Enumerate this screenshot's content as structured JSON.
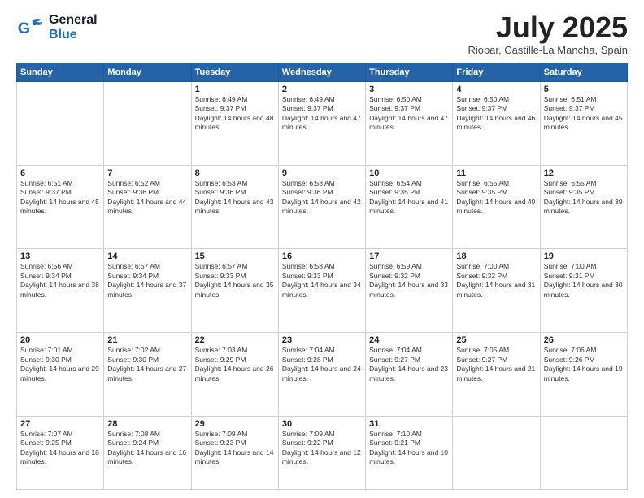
{
  "header": {
    "logo_general": "General",
    "logo_blue": "Blue",
    "month": "July 2025",
    "location": "Riopar, Castille-La Mancha, Spain"
  },
  "weekdays": [
    "Sunday",
    "Monday",
    "Tuesday",
    "Wednesday",
    "Thursday",
    "Friday",
    "Saturday"
  ],
  "weeks": [
    [
      {
        "day": "",
        "sunrise": "",
        "sunset": "",
        "daylight": ""
      },
      {
        "day": "",
        "sunrise": "",
        "sunset": "",
        "daylight": ""
      },
      {
        "day": "1",
        "sunrise": "Sunrise: 6:49 AM",
        "sunset": "Sunset: 9:37 PM",
        "daylight": "Daylight: 14 hours and 48 minutes."
      },
      {
        "day": "2",
        "sunrise": "Sunrise: 6:49 AM",
        "sunset": "Sunset: 9:37 PM",
        "daylight": "Daylight: 14 hours and 47 minutes."
      },
      {
        "day": "3",
        "sunrise": "Sunrise: 6:50 AM",
        "sunset": "Sunset: 9:37 PM",
        "daylight": "Daylight: 14 hours and 47 minutes."
      },
      {
        "day": "4",
        "sunrise": "Sunrise: 6:50 AM",
        "sunset": "Sunset: 9:37 PM",
        "daylight": "Daylight: 14 hours and 46 minutes."
      },
      {
        "day": "5",
        "sunrise": "Sunrise: 6:51 AM",
        "sunset": "Sunset: 9:37 PM",
        "daylight": "Daylight: 14 hours and 45 minutes."
      }
    ],
    [
      {
        "day": "6",
        "sunrise": "Sunrise: 6:51 AM",
        "sunset": "Sunset: 9:37 PM",
        "daylight": "Daylight: 14 hours and 45 minutes."
      },
      {
        "day": "7",
        "sunrise": "Sunrise: 6:52 AM",
        "sunset": "Sunset: 9:36 PM",
        "daylight": "Daylight: 14 hours and 44 minutes."
      },
      {
        "day": "8",
        "sunrise": "Sunrise: 6:53 AM",
        "sunset": "Sunset: 9:36 PM",
        "daylight": "Daylight: 14 hours and 43 minutes."
      },
      {
        "day": "9",
        "sunrise": "Sunrise: 6:53 AM",
        "sunset": "Sunset: 9:36 PM",
        "daylight": "Daylight: 14 hours and 42 minutes."
      },
      {
        "day": "10",
        "sunrise": "Sunrise: 6:54 AM",
        "sunset": "Sunset: 9:35 PM",
        "daylight": "Daylight: 14 hours and 41 minutes."
      },
      {
        "day": "11",
        "sunrise": "Sunrise: 6:55 AM",
        "sunset": "Sunset: 9:35 PM",
        "daylight": "Daylight: 14 hours and 40 minutes."
      },
      {
        "day": "12",
        "sunrise": "Sunrise: 6:55 AM",
        "sunset": "Sunset: 9:35 PM",
        "daylight": "Daylight: 14 hours and 39 minutes."
      }
    ],
    [
      {
        "day": "13",
        "sunrise": "Sunrise: 6:56 AM",
        "sunset": "Sunset: 9:34 PM",
        "daylight": "Daylight: 14 hours and 38 minutes."
      },
      {
        "day": "14",
        "sunrise": "Sunrise: 6:57 AM",
        "sunset": "Sunset: 9:34 PM",
        "daylight": "Daylight: 14 hours and 37 minutes."
      },
      {
        "day": "15",
        "sunrise": "Sunrise: 6:57 AM",
        "sunset": "Sunset: 9:33 PM",
        "daylight": "Daylight: 14 hours and 35 minutes."
      },
      {
        "day": "16",
        "sunrise": "Sunrise: 6:58 AM",
        "sunset": "Sunset: 9:33 PM",
        "daylight": "Daylight: 14 hours and 34 minutes."
      },
      {
        "day": "17",
        "sunrise": "Sunrise: 6:59 AM",
        "sunset": "Sunset: 9:32 PM",
        "daylight": "Daylight: 14 hours and 33 minutes."
      },
      {
        "day": "18",
        "sunrise": "Sunrise: 7:00 AM",
        "sunset": "Sunset: 9:32 PM",
        "daylight": "Daylight: 14 hours and 31 minutes."
      },
      {
        "day": "19",
        "sunrise": "Sunrise: 7:00 AM",
        "sunset": "Sunset: 9:31 PM",
        "daylight": "Daylight: 14 hours and 30 minutes."
      }
    ],
    [
      {
        "day": "20",
        "sunrise": "Sunrise: 7:01 AM",
        "sunset": "Sunset: 9:30 PM",
        "daylight": "Daylight: 14 hours and 29 minutes."
      },
      {
        "day": "21",
        "sunrise": "Sunrise: 7:02 AM",
        "sunset": "Sunset: 9:30 PM",
        "daylight": "Daylight: 14 hours and 27 minutes."
      },
      {
        "day": "22",
        "sunrise": "Sunrise: 7:03 AM",
        "sunset": "Sunset: 9:29 PM",
        "daylight": "Daylight: 14 hours and 26 minutes."
      },
      {
        "day": "23",
        "sunrise": "Sunrise: 7:04 AM",
        "sunset": "Sunset: 9:28 PM",
        "daylight": "Daylight: 14 hours and 24 minutes."
      },
      {
        "day": "24",
        "sunrise": "Sunrise: 7:04 AM",
        "sunset": "Sunset: 9:27 PM",
        "daylight": "Daylight: 14 hours and 23 minutes."
      },
      {
        "day": "25",
        "sunrise": "Sunrise: 7:05 AM",
        "sunset": "Sunset: 9:27 PM",
        "daylight": "Daylight: 14 hours and 21 minutes."
      },
      {
        "day": "26",
        "sunrise": "Sunrise: 7:06 AM",
        "sunset": "Sunset: 9:26 PM",
        "daylight": "Daylight: 14 hours and 19 minutes."
      }
    ],
    [
      {
        "day": "27",
        "sunrise": "Sunrise: 7:07 AM",
        "sunset": "Sunset: 9:25 PM",
        "daylight": "Daylight: 14 hours and 18 minutes."
      },
      {
        "day": "28",
        "sunrise": "Sunrise: 7:08 AM",
        "sunset": "Sunset: 9:24 PM",
        "daylight": "Daylight: 14 hours and 16 minutes."
      },
      {
        "day": "29",
        "sunrise": "Sunrise: 7:09 AM",
        "sunset": "Sunset: 9:23 PM",
        "daylight": "Daylight: 14 hours and 14 minutes."
      },
      {
        "day": "30",
        "sunrise": "Sunrise: 7:09 AM",
        "sunset": "Sunset: 9:22 PM",
        "daylight": "Daylight: 14 hours and 12 minutes."
      },
      {
        "day": "31",
        "sunrise": "Sunrise: 7:10 AM",
        "sunset": "Sunset: 9:21 PM",
        "daylight": "Daylight: 14 hours and 10 minutes."
      },
      {
        "day": "",
        "sunrise": "",
        "sunset": "",
        "daylight": ""
      },
      {
        "day": "",
        "sunrise": "",
        "sunset": "",
        "daylight": ""
      }
    ]
  ]
}
